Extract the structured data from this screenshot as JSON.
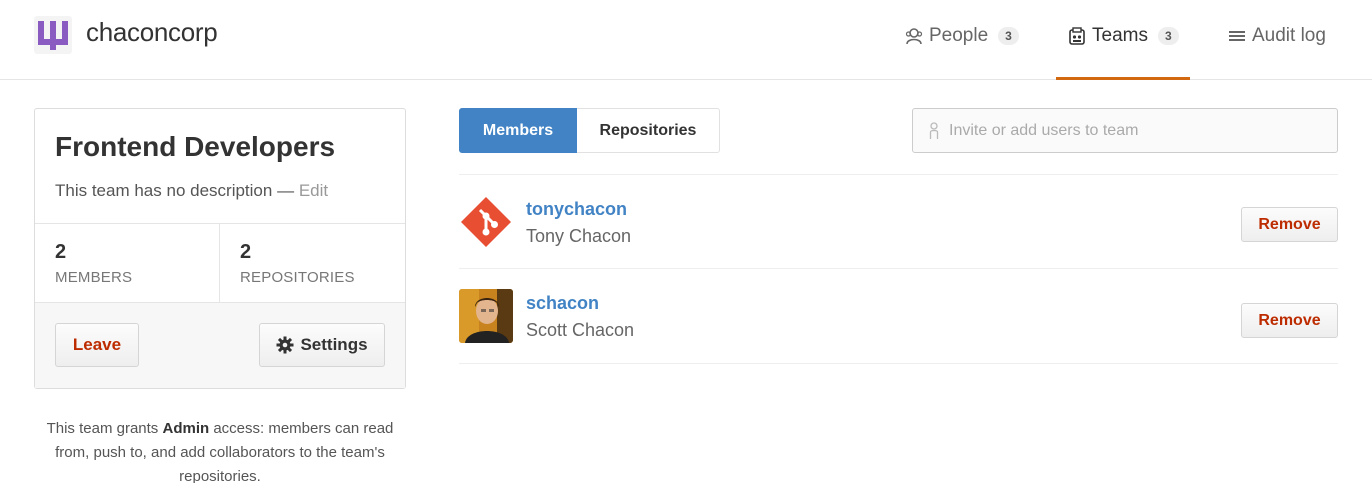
{
  "org": {
    "name": "chaconcorp",
    "logo_icon": "github-org-logo-icon",
    "logo_color": "#8a5cc2"
  },
  "nav": {
    "people": {
      "label": "People",
      "count": "3",
      "icon": "people-icon"
    },
    "teams": {
      "label": "Teams",
      "count": "3",
      "icon": "teams-icon",
      "active": true
    },
    "audit": {
      "label": "Audit log",
      "icon": "list-icon"
    },
    "active_color": "#d26911"
  },
  "team": {
    "title": "Frontend Developers",
    "description": "This team has no description",
    "separator": "—",
    "edit_label": "Edit",
    "members_count": "2",
    "members_label": "MEMBERS",
    "repos_count": "2",
    "repos_label": "REPOSITORIES",
    "leave_label": "Leave",
    "settings_label": "Settings"
  },
  "access_note": {
    "prefix": "This team grants",
    "level": "Admin",
    "suffix": "access: members can read from, push to, and add collaborators to the team's repositories."
  },
  "tabs": [
    {
      "label": "Members",
      "active": true
    },
    {
      "label": "Repositories",
      "active": false
    }
  ],
  "invite": {
    "placeholder": "Invite or add users to team"
  },
  "members": [
    {
      "login": "tonychacon",
      "name": "Tony Chacon",
      "remove_label": "Remove",
      "avatar": "git-logo-icon"
    },
    {
      "login": "schacon",
      "name": "Scott Chacon",
      "remove_label": "Remove",
      "avatar": "user-photo"
    }
  ],
  "colors": {
    "accent": "#4183c4",
    "danger": "#bd2c00"
  }
}
